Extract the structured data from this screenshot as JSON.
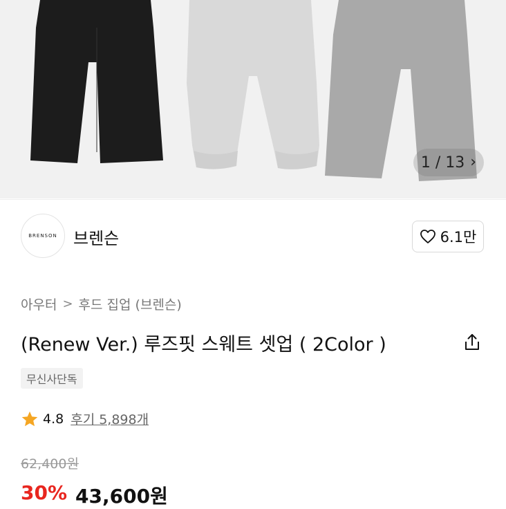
{
  "gallery": {
    "counter": "1 / 13",
    "next_icon": "chevron-right-icon"
  },
  "brand": {
    "logo_text": "BRENSON",
    "name": "브렌슨",
    "likes": "6.1만",
    "like_icon": "heart-icon"
  },
  "breadcrumb": {
    "category": "아우터",
    "separator": ">",
    "subcategory": "후드 집업 (브렌슨)"
  },
  "product": {
    "title": "(Renew Ver.) 루즈핏 스웨트 셋업 ( 2Color )",
    "badge": "무신사단독",
    "rating": "4.8",
    "reviews": "후기 5,898개",
    "original_price": "62,400원",
    "discount": "30%",
    "price": "43,600원"
  },
  "colors": {
    "accent": "#e8261f",
    "star": "#f5a623",
    "hero_bg": "#f1f1f1"
  }
}
